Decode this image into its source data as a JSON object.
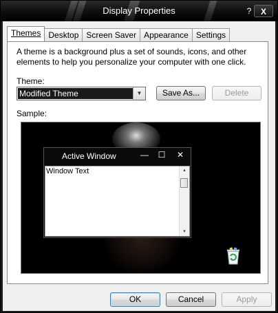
{
  "window": {
    "title": "Display Properties",
    "help_glyph": "?",
    "close_glyph": "X"
  },
  "tabs": [
    {
      "label": "Themes",
      "active": true
    },
    {
      "label": "Desktop",
      "active": false
    },
    {
      "label": "Screen Saver",
      "active": false
    },
    {
      "label": "Appearance",
      "active": false
    },
    {
      "label": "Settings",
      "active": false
    }
  ],
  "themes_panel": {
    "description": "A theme is a background plus a set of sounds, icons, and other elements to help you personalize your computer with one click.",
    "theme_label": "Theme:",
    "theme_value": "Modified Theme",
    "save_as_label": "Save As...",
    "delete_label": "Delete",
    "sample_label": "Sample:"
  },
  "sample_window": {
    "title": "Active Window",
    "body_text": "Window Text",
    "min_glyph": "—",
    "max_glyph": "☐",
    "close_glyph": "✕"
  },
  "footer": {
    "ok_label": "OK",
    "cancel_label": "Cancel",
    "apply_label": "Apply"
  },
  "icons": {
    "recycle_bin": "recycle-bin-icon"
  },
  "colors": {
    "titlebar": "#000000",
    "selection": "#1b1b1b",
    "default_button_border": "#3c7fb1"
  }
}
